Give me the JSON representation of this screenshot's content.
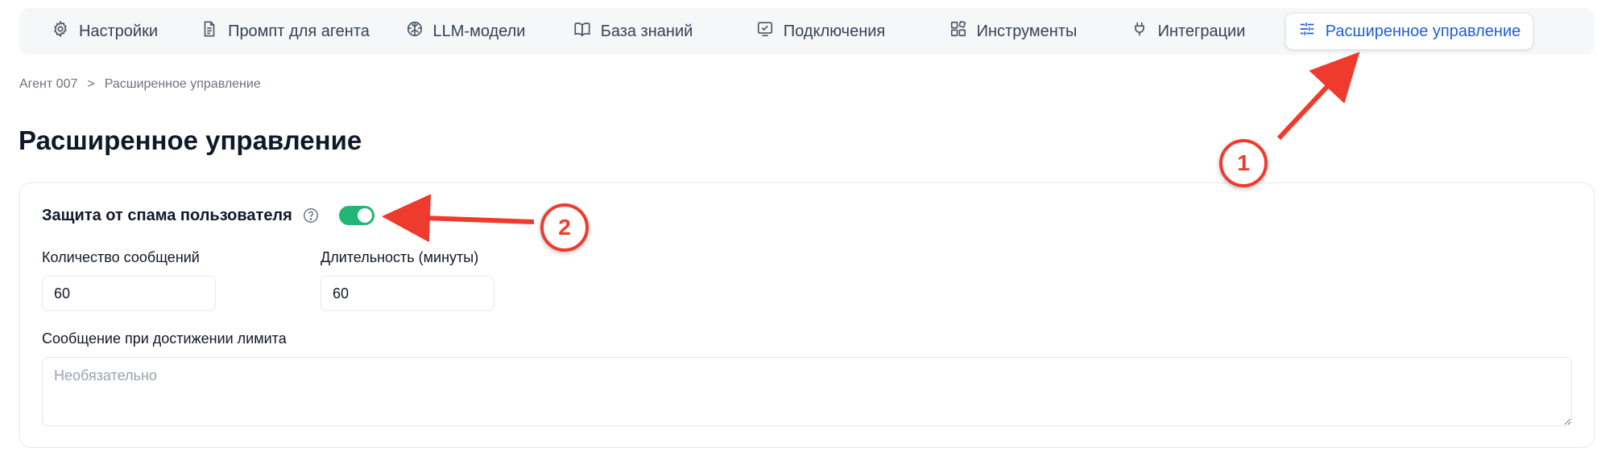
{
  "tabs": [
    {
      "label": "Настройки",
      "icon": "gear-icon"
    },
    {
      "label": "Промпт для агента",
      "icon": "document-icon"
    },
    {
      "label": "LLM-модели",
      "icon": "brain-icon"
    },
    {
      "label": "База знаний",
      "icon": "book-icon"
    },
    {
      "label": "Подключения",
      "icon": "checkbox-window-icon"
    },
    {
      "label": "Инструменты",
      "icon": "blocks-icon"
    },
    {
      "label": "Интеграции",
      "icon": "plug-icon"
    },
    {
      "label": "Расширенное управление",
      "icon": "sliders-icon",
      "active": true
    }
  ],
  "breadcrumb": {
    "root": "Агент 007",
    "separator": ">",
    "current": "Расширенное управление"
  },
  "page_title": "Расширенное управление",
  "spam_protection": {
    "title": "Защита от спама пользователя",
    "enabled": true,
    "messages_label": "Количество сообщений",
    "messages_value": "60",
    "duration_label": "Длительность (минуты)",
    "duration_value": "60",
    "limit_message_label": "Сообщение при достижении лимита",
    "limit_message_placeholder": "Необязательно"
  },
  "annotations": [
    {
      "number": "1",
      "color": "#ef3b2d"
    },
    {
      "number": "2",
      "color": "#ef3b2d"
    }
  ],
  "colors": {
    "accent": "#1e5fd7",
    "toggle_on": "#22b573",
    "annotation": "#ef3b2d"
  }
}
